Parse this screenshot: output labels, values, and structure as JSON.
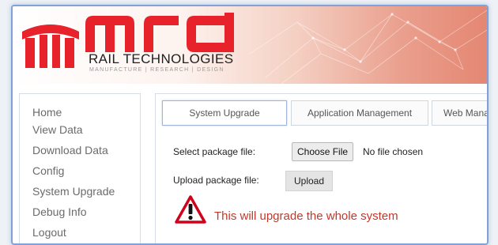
{
  "brand": {
    "logo_name": "mrd",
    "subtitle": "RAIL TECHNOLOGIES",
    "tagline": "MANUFACTURE | RESEARCH | DESIGN",
    "accent_color": "#e8222b"
  },
  "sidebar": {
    "items": [
      {
        "label": "Home"
      },
      {
        "label": "View Data"
      },
      {
        "label": "Download Data"
      },
      {
        "label": "Config"
      },
      {
        "label": "System Upgrade"
      },
      {
        "label": "Debug Info"
      },
      {
        "label": "Logout"
      }
    ]
  },
  "tabs": [
    {
      "label": "System Upgrade",
      "active": true
    },
    {
      "label": "Application Management",
      "active": false
    },
    {
      "label": "Web Mana",
      "active": false
    }
  ],
  "form": {
    "select_label": "Select package file:",
    "choose_button": "Choose File",
    "file_status": "No file chosen",
    "upload_label": "Upload package file:",
    "upload_button": "Upload"
  },
  "warning": {
    "icon": "warning-triangle-icon",
    "text": "This will upgrade the whole system",
    "color": "#c0392b"
  }
}
